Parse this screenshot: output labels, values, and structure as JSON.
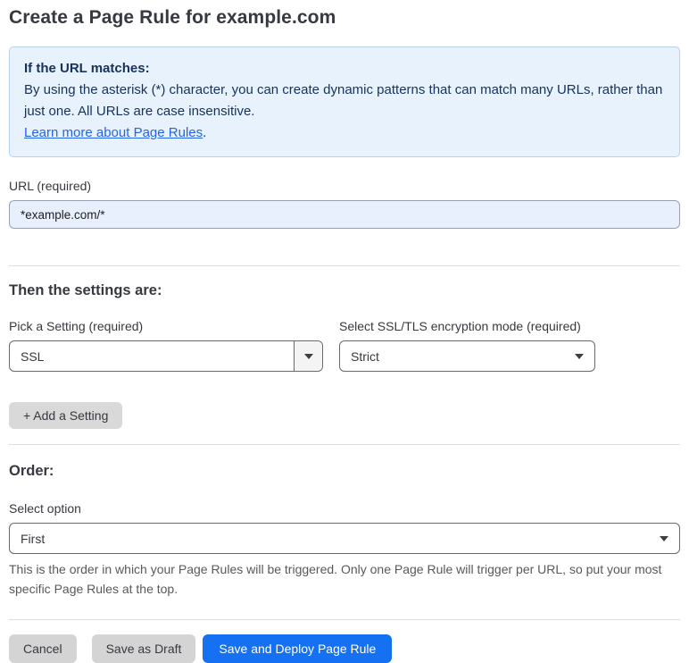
{
  "page": {
    "title": "Create a Page Rule for example.com"
  },
  "info_box": {
    "heading": "If the URL matches:",
    "body": "By using the asterisk (*) character, you can create dynamic patterns that can match many URLs, rather than just one. All URLs are case insensitive.",
    "link_label": "Learn more about Page Rules",
    "link_suffix": "."
  },
  "url_field": {
    "label": "URL (required)",
    "value": "*example.com/*"
  },
  "settings_section": {
    "heading": "Then the settings are:",
    "setting_select": {
      "label": "Pick a Setting (required)",
      "value": "SSL"
    },
    "mode_select": {
      "label": "Select SSL/TLS encryption mode (required)",
      "value": "Strict"
    },
    "add_setting_label": "+ Add a Setting"
  },
  "order_section": {
    "heading": "Order:",
    "select_label": "Select option",
    "select_value": "First",
    "help_text": "This is the order in which your Page Rules will be triggered. Only one Page Rule will trigger per URL, so put your most specific Page Rules at the top."
  },
  "actions": {
    "cancel_label": "Cancel",
    "save_draft_label": "Save as Draft",
    "save_deploy_label": "Save and Deploy Page Rule"
  },
  "icons": {
    "dropdown_arrow": "chevron-down-icon"
  },
  "colors": {
    "accent_blue": "#1670f2",
    "info_bg": "#e8f2fc",
    "info_border": "#b5d3ee",
    "info_text": "#16325c",
    "link_blue": "#2563eb",
    "input_autofill_bg": "#e8f0fe",
    "gray_button_bg": "#d4d4d4",
    "help_text_gray": "#595959"
  }
}
